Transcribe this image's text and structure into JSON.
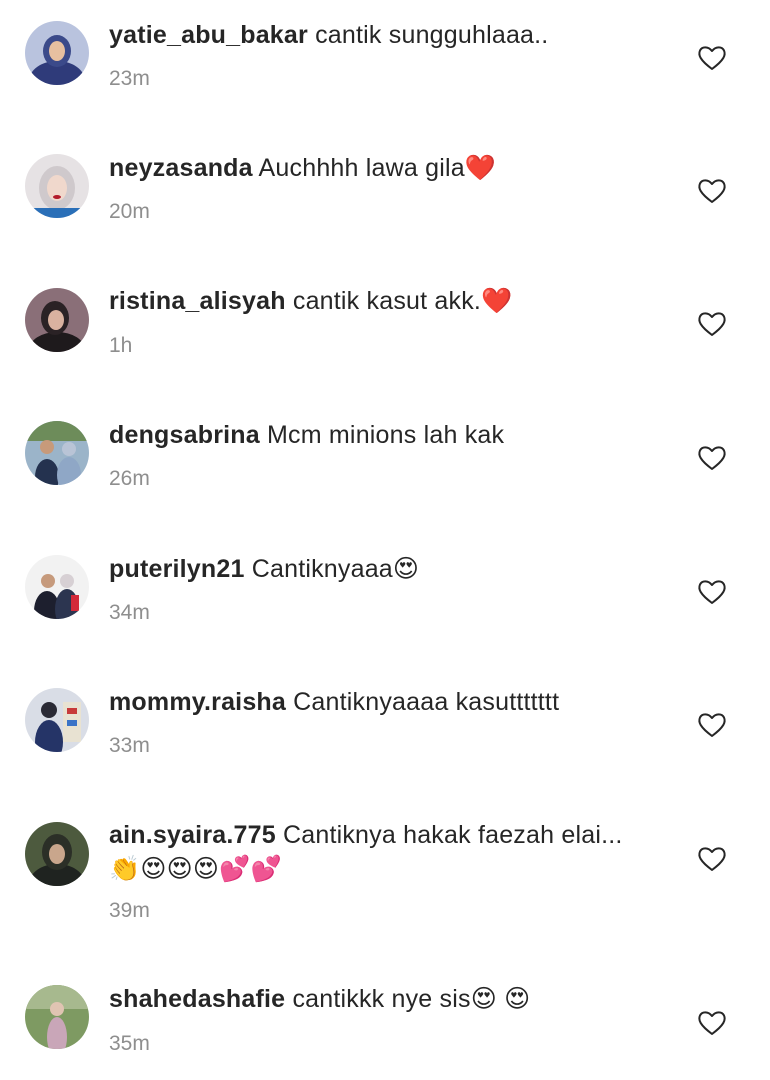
{
  "comments": [
    {
      "username": "yatie_abu_bakar",
      "text": "cantik sungguhlaaa..",
      "time": "23m",
      "avatar_color": "#3b4a8a"
    },
    {
      "username": "neyzasanda",
      "text": "Auchhhh lawa gila❤️",
      "time": "20m",
      "avatar_color": "#d8d4d6"
    },
    {
      "username": "ristina_alisyah",
      "text": "cantik kasut akk.❤️",
      "time": "1h",
      "avatar_color": "#5a3a44"
    },
    {
      "username": "dengsabrina",
      "text": "Mcm minions lah kak",
      "time": "26m",
      "avatar_color": "#6c7e9e"
    },
    {
      "username": "puterilyn21",
      "text": "Cantiknyaaa😍",
      "time": "34m",
      "avatar_color": "#2a2a35"
    },
    {
      "username": "mommy.raisha",
      "text": "Cantiknyaaaa kasuttttttt",
      "time": "33m",
      "avatar_color": "#2e3f73"
    },
    {
      "username": "ain.syaira.775",
      "text": "Cantiknya hakak faezah elai...👏😍😍😍💕💕",
      "time": "39m",
      "avatar_color": "#3e4632"
    },
    {
      "username": "shahedashafie",
      "text": "cantikkk nye sis😍 😍",
      "time": "35m",
      "avatar_color": "#5f7a48"
    }
  ],
  "icons": {
    "like": "heart-outline-icon"
  }
}
